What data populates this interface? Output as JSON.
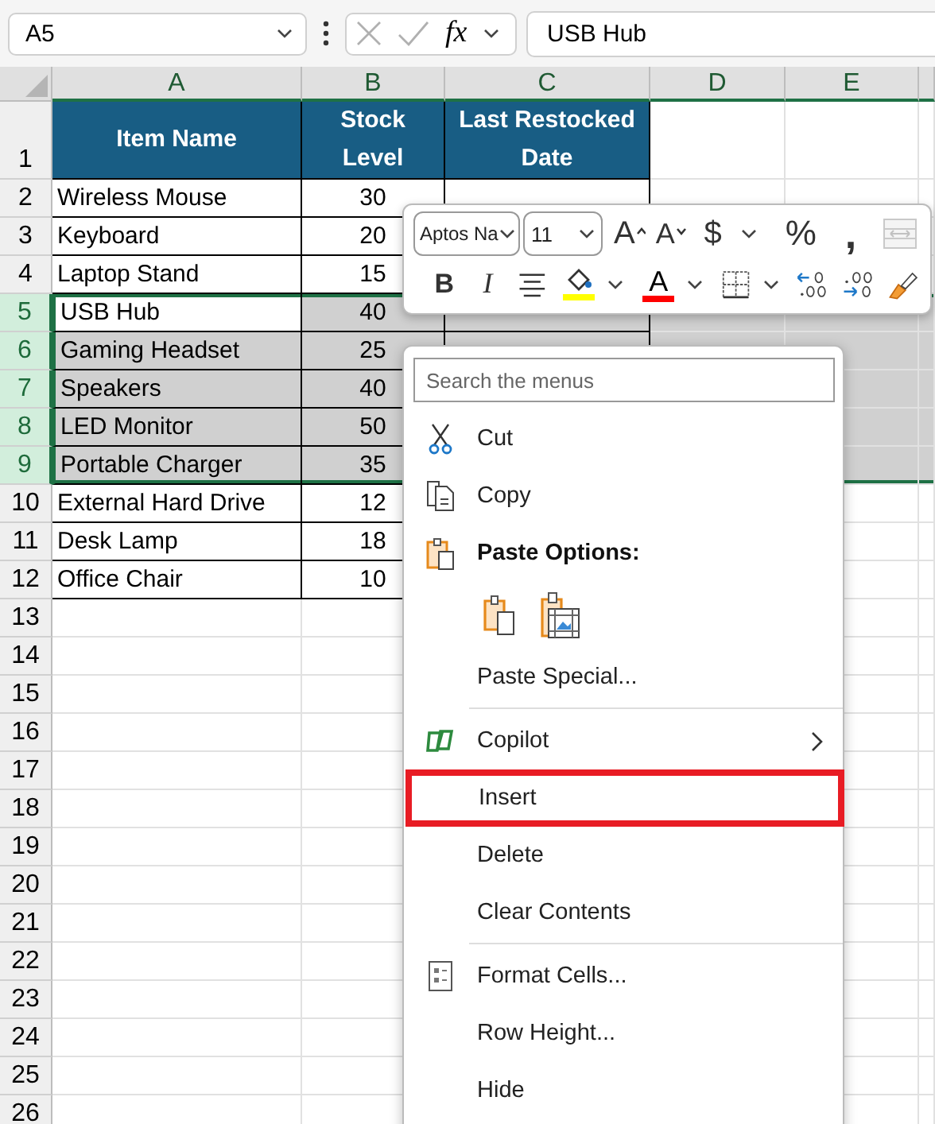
{
  "formula_bar": {
    "name_box": "A5",
    "function_label": "fx",
    "formula": "USB Hub"
  },
  "sheet": {
    "columns": [
      "A",
      "B",
      "C",
      "D",
      "E"
    ],
    "header": {
      "number": "1",
      "cells": [
        "Item Name",
        "Stock Level",
        "Last Restocked Date"
      ]
    },
    "rows": [
      {
        "number": "2",
        "item": "Wireless Mouse",
        "stock": "30",
        "selected": false,
        "active": false
      },
      {
        "number": "3",
        "item": "Keyboard",
        "stock": "20",
        "selected": false,
        "active": false
      },
      {
        "number": "4",
        "item": "Laptop Stand",
        "stock": "15",
        "selected": false,
        "active": false
      },
      {
        "number": "5",
        "item": "USB Hub",
        "stock": "40",
        "selected": true,
        "active": true
      },
      {
        "number": "6",
        "item": "Gaming Headset",
        "stock": "25",
        "selected": true,
        "active": false
      },
      {
        "number": "7",
        "item": "Speakers",
        "stock": "40",
        "selected": true,
        "active": false
      },
      {
        "number": "8",
        "item": "LED Monitor",
        "stock": "50",
        "selected": true,
        "active": false
      },
      {
        "number": "9",
        "item": "Portable Charger",
        "stock": "35",
        "selected": true,
        "active": false
      },
      {
        "number": "10",
        "item": "External Hard Drive",
        "stock": "12",
        "selected": false,
        "active": false
      },
      {
        "number": "11",
        "item": "Desk Lamp",
        "stock": "18",
        "selected": false,
        "active": false
      },
      {
        "number": "12",
        "item": "Office Chair",
        "stock": "10",
        "selected": false,
        "active": false
      }
    ],
    "empty_rows": [
      "13",
      "14",
      "15",
      "16",
      "17",
      "18",
      "19",
      "20",
      "21",
      "22",
      "23",
      "24",
      "25",
      "26"
    ]
  },
  "mini_toolbar": {
    "row1": [
      {
        "kind": "font-field",
        "value": "Aptos Na"
      },
      {
        "kind": "size-field",
        "value": "11"
      },
      {
        "kind": "grow-font",
        "glyph": "A"
      },
      {
        "kind": "shrink-font",
        "glyph": "A"
      },
      {
        "kind": "currency",
        "glyph": "$",
        "dropdown": true
      },
      {
        "kind": "percent",
        "glyph": "%"
      },
      {
        "kind": "comma",
        "glyph": ","
      },
      {
        "kind": "merge",
        "disabled": true
      }
    ],
    "row2": [
      {
        "kind": "bold",
        "glyph": "B"
      },
      {
        "kind": "italic",
        "glyph": "I"
      },
      {
        "kind": "align-center"
      },
      {
        "kind": "fill-color",
        "color": "#ffff00",
        "dropdown": true
      },
      {
        "kind": "font-color",
        "glyph": "A",
        "color": "#ff0000",
        "dropdown": true
      },
      {
        "kind": "borders",
        "dropdown": true
      },
      {
        "kind": "increase-decimal"
      },
      {
        "kind": "decrease-decimal"
      },
      {
        "kind": "format-painter"
      }
    ]
  },
  "context_menu": {
    "search_placeholder": "Search the menus",
    "items": [
      {
        "kind": "cut",
        "label": "Cut",
        "submenu": false,
        "highlighted": false
      },
      {
        "kind": "copy",
        "label": "Copy",
        "submenu": false,
        "highlighted": false
      },
      {
        "kind": "paste-heading",
        "label": "Paste Options:"
      },
      {
        "kind": "paste-buttons"
      },
      {
        "kind": "item",
        "label": "Paste Special...",
        "submenu": false,
        "highlighted": false
      },
      {
        "kind": "separator"
      },
      {
        "kind": "copilot",
        "label": "Copilot",
        "submenu": true,
        "highlighted": false
      },
      {
        "kind": "item",
        "label": "Insert",
        "submenu": false,
        "highlighted": true
      },
      {
        "kind": "item",
        "label": "Delete",
        "submenu": false,
        "highlighted": false
      },
      {
        "kind": "item",
        "label": "Clear Contents",
        "submenu": false,
        "highlighted": false
      },
      {
        "kind": "separator"
      },
      {
        "kind": "format-cells",
        "label": "Format Cells...",
        "submenu": false,
        "highlighted": false
      },
      {
        "kind": "item",
        "label": "Row Height...",
        "submenu": false,
        "highlighted": false
      },
      {
        "kind": "item",
        "label": "Hide",
        "submenu": false,
        "highlighted": false
      }
    ]
  }
}
